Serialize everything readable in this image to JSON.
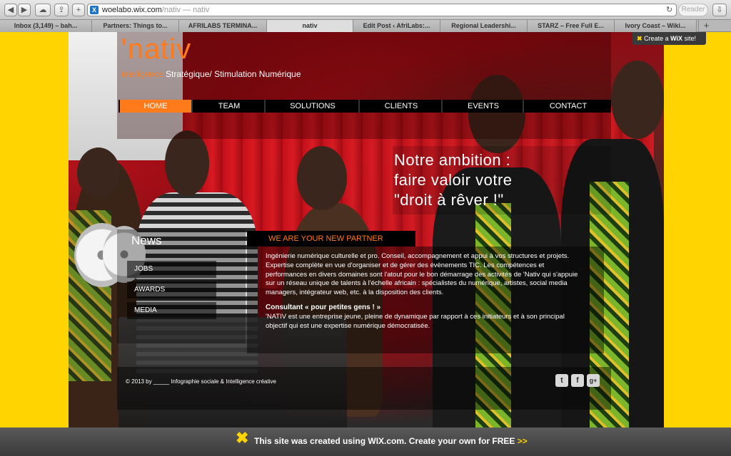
{
  "browser": {
    "url_domain": "woelabo.wix.com",
    "url_path": "/nativ",
    "page_title_hint": " — nativ",
    "reader_label": "Reader",
    "tabs": [
      {
        "label": "Inbox (3,149) – bah..."
      },
      {
        "label": "Partners: Things to..."
      },
      {
        "label": "AFRILABS TERMINA..."
      },
      {
        "label": "nativ"
      },
      {
        "label": "Edit Post ‹ AfriLabs:..."
      },
      {
        "label": "Regional Leadershi..."
      },
      {
        "label": "STARZ – Free Full E..."
      },
      {
        "label": "Ivory Coast – Wiki..."
      }
    ]
  },
  "site": {
    "logo": "'nativ",
    "tagline_highlight": "Intelligence",
    "tagline_rest": " Stratégique/ Stimulation Numérique",
    "nav": [
      {
        "label": "HOME"
      },
      {
        "label": "TEAM"
      },
      {
        "label": "SOLUTIONS"
      },
      {
        "label": "CLIENTS"
      },
      {
        "label": "EVENTS"
      },
      {
        "label": "CONTACT"
      }
    ],
    "ambition": [
      "Notre ambition :",
      "faire valoir votre",
      "\"droit à rêver !\""
    ],
    "news": {
      "title": "News",
      "items": [
        {
          "label": "JOBS"
        },
        {
          "label": "AWARDS"
        },
        {
          "label": "MEDIA"
        }
      ]
    },
    "partner_heading": "WE ARE YOUR NEW PARTNER",
    "paragraph1": "Ingénierie numérique culturelle et pro. Conseil, accompagnement et appui à vos structures et projets. Expertise complète en vue d'organiser et de gérer des évènements TIC. Les compétences et performances en divers domaines sont l'atout pour le bon démarrage des activités de 'Nativ qui s'appuie sur un réseau unique de talents à l'échelle africain : spécialistes du numérique, artistes, social media managers, intégrateur web, etc. à la disposition des clients.",
    "subheading": "Consultant « pour petites gens ! »",
    "paragraph2": "'NATIV est une entreprise jeune, pleine de dynamique par rapport à ces initiateurs et à son principal objectif qui est une expertise numérique démocratisée.",
    "copyright": "© 2013 by _____ Infographie sociale & Intelligence créative",
    "social": [
      {
        "label": "t"
      },
      {
        "label": "f"
      },
      {
        "label": "g+"
      }
    ]
  },
  "wix": {
    "badge_prefix": "Create a ",
    "badge_brand": "WiX",
    "badge_suffix": " site!",
    "bottom_text": "This site was created using WIX.com. Create your own for FREE ",
    "bottom_link": ">>"
  }
}
